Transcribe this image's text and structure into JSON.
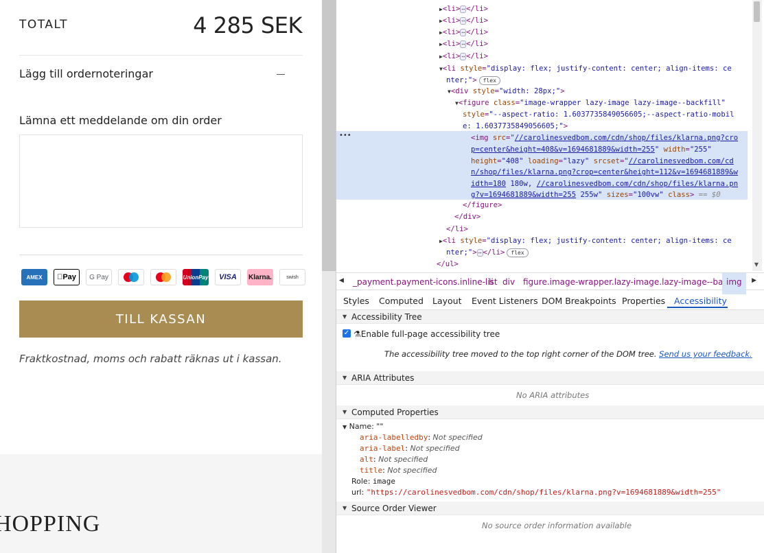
{
  "cart": {
    "total_label": "TOTALT",
    "total_value": "4 285 SEK",
    "notes_toggle": "Lägg till ordernoteringar",
    "message_label": "Lämna ett meddelande om din order",
    "message_value": "",
    "payment_icons": [
      {
        "name": "amex-icon",
        "label": "AMEX"
      },
      {
        "name": "apple-pay-icon",
        "label": "Pay"
      },
      {
        "name": "google-pay-icon",
        "label": "G Pay"
      },
      {
        "name": "maestro-icon",
        "label": ""
      },
      {
        "name": "mastercard-icon",
        "label": ""
      },
      {
        "name": "unionpay-icon",
        "label": "UnionPay"
      },
      {
        "name": "visa-icon",
        "label": "VISA"
      },
      {
        "name": "klarna-icon",
        "label": "Klarna."
      },
      {
        "name": "swish-icon",
        "label": "swish"
      }
    ],
    "checkout_button": "TILL KASSAN",
    "shipping_note": "Fraktkostnad, moms och rabatt räknas ut i kassan.",
    "footer_heading": "HOPPING"
  },
  "devtools": {
    "breadcrumbs": [
      "_payment.payment-icons.inline-list",
      "li",
      "div",
      "figure.image-wrapper.lazy-image.lazy-image--backfill",
      "img"
    ],
    "tabs": [
      "Styles",
      "Computed",
      "Layout",
      "Event Listeners",
      "DOM Breakpoints",
      "Properties",
      "Accessibility"
    ],
    "active_tab": "Accessibility",
    "sections": {
      "tree": "Accessibility Tree",
      "aria": "ARIA Attributes",
      "computed": "Computed Properties",
      "source": "Source Order Viewer"
    },
    "enable_tree_label": "Enable full-page accessibility tree",
    "tree_note": "The accessibility tree moved to the top right corner of the DOM tree.",
    "feedback_link": "Send us your feedback.",
    "no_aria": "No ARIA attributes",
    "name_row": "Name: \"\"",
    "name_props": [
      {
        "key": "aria-labelledby",
        "value": "Not specified"
      },
      {
        "key": "aria-label",
        "value": "Not specified"
      },
      {
        "key": "alt",
        "value": "Not specified"
      },
      {
        "key": "title",
        "value": "Not specified"
      }
    ],
    "role_label": "Role:",
    "role_value": "image",
    "url_label": "url:",
    "url_value": "\"https://carolinesvedbom.com/cdn/shop/files/klarna.png?v=1694681889&width=255\"",
    "no_source": "No source order information available",
    "flex_badge": "flex",
    "dom_lines": {
      "li": "<li>",
      "li_close": "</li>",
      "li_flex_open": "<li ",
      "li_flex_attr": "style",
      "li_flex_val_1": "\"display: flex; justify-content: center; align-items: ce",
      "li_flex_val_2": "nter;\"",
      "div_open": "<div ",
      "div_attr": "style",
      "div_val": "\"width: 28px;\"",
      "fig_open": "<figure ",
      "fig_class_attr": "class",
      "fig_class_val": "\"image-wrapper lazy-image lazy-image--backfill\"",
      "fig_style_attr": "style",
      "fig_style_val_1": "\"--aspect-ratio: 1.6037735849056605;--aspect-ratio-mobil",
      "fig_style_val_2": "e: 1.6037735849056605;\"",
      "img_open": "<img ",
      "img_src_attr": "src",
      "img_src_1": "//carolinesvedbom.com/cdn/shop/files/klarna.png?cro",
      "img_src_2": "p=center&height=408&v=1694681889&width=255",
      "img_width_attr": "width",
      "img_width_val": "\"255\"",
      "img_height_attr": "height",
      "img_height_val": "\"408\"",
      "img_loading_attr": "loading",
      "img_loading_val": "\"lazy\"",
      "img_srcset_attr": "srcset",
      "img_srcset_1": "//carolinesvedbom.com/cd",
      "img_srcset_2": "n/shop/files/klarna.png?crop=center&height=112&v=1694681889&w",
      "img_srcset_3": "idth=180",
      "img_srcset_4": " 180w, ",
      "img_srcset_5": "//carolinesvedbom.com/cdn/shop/files/klarna.pn",
      "img_srcset_6": "g?v=1694681889&width=255",
      "img_srcset_7": " 255w\"",
      "img_sizes_attr": "sizes",
      "img_sizes_val": "\"100vw\"",
      "img_class_attr": "class",
      "eq_sel": "== $0",
      "fig_close": "</figure>",
      "div_close": "</div>",
      "ul_close": "</ul>"
    }
  },
  "colors": {
    "checkout_gold": "#a88c52",
    "devtools_accent": "#1a56c5",
    "selection_blue": "#d7e4f8"
  }
}
